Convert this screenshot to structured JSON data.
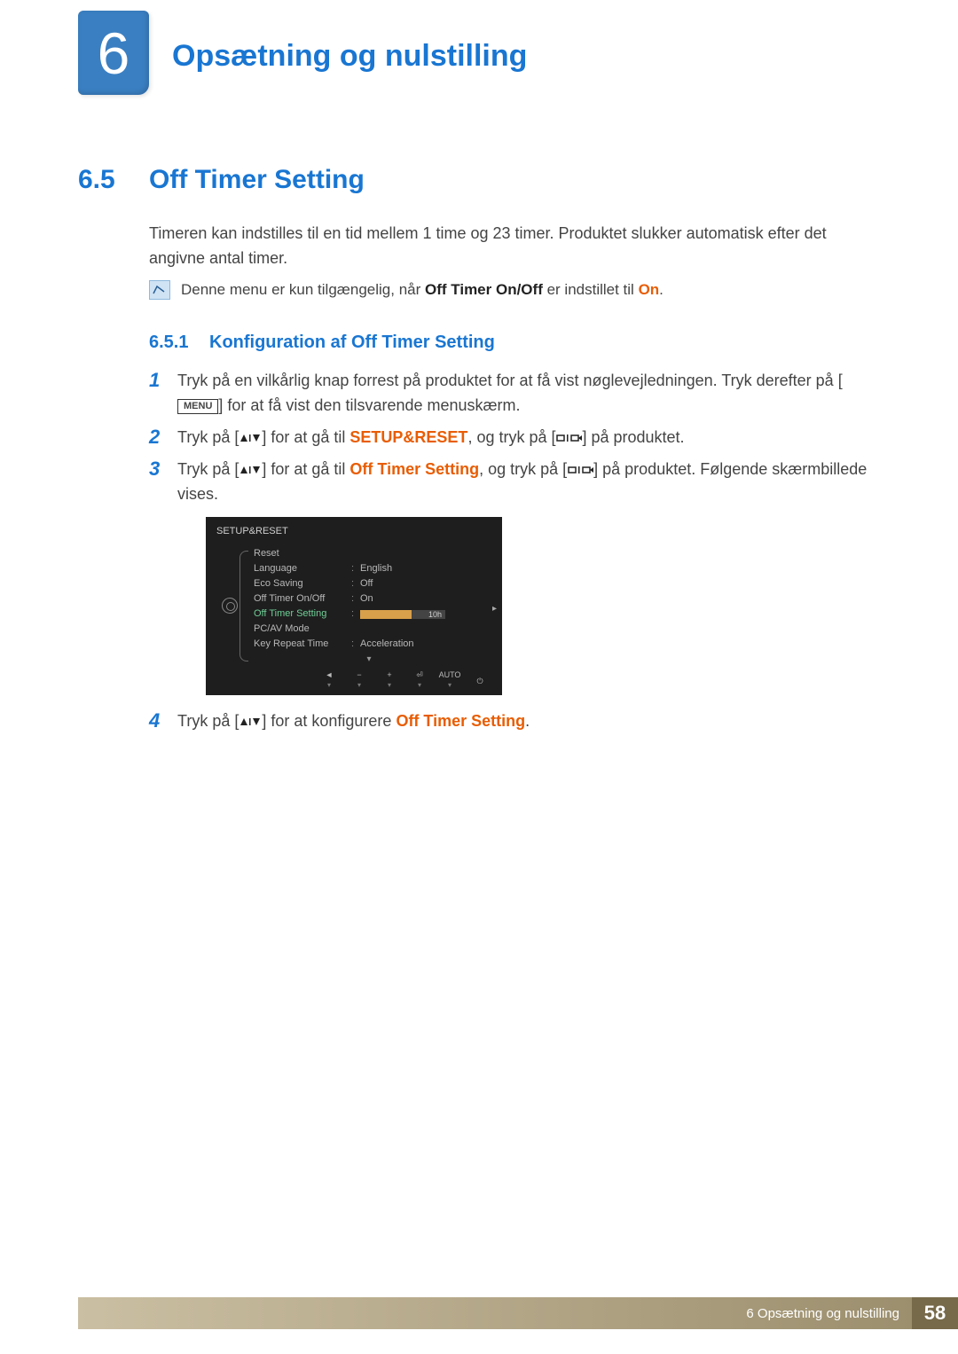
{
  "chapter": {
    "number": "6",
    "title": "Opsætning og nulstilling"
  },
  "section": {
    "number": "6.5",
    "title": "Off Timer Setting"
  },
  "intro": "Timeren kan indstilles til en tid mellem 1 time og 23 timer. Produktet slukker automatisk efter det angivne antal timer.",
  "note": {
    "prefix": "Denne menu er kun tilgængelig, når ",
    "bold1": "Off Timer On/Off",
    "mid": " er indstillet til ",
    "bold2": "On",
    "suffix": "."
  },
  "subsection": {
    "number": "6.5.1",
    "title": "Konfiguration af Off Timer Setting"
  },
  "steps": {
    "s1": {
      "num": "1",
      "a": "Tryk på en vilkårlig knap forrest på produktet for at få vist nøglevejledningen. Tryk derefter på [",
      "menu": "MENU",
      "b": "] for at få vist den tilsvarende menuskærm."
    },
    "s2": {
      "num": "2",
      "a": "Tryk på [",
      "b": "] for at gå til ",
      "target": "SETUP&RESET",
      "c": ", og tryk på [",
      "d": "] på produktet."
    },
    "s3": {
      "num": "3",
      "a": "Tryk på [",
      "b": "] for at gå til ",
      "target": "Off Timer Setting",
      "c": ", og tryk på [",
      "d": "] på produktet. Følgende skærmbillede vises."
    },
    "s4": {
      "num": "4",
      "a": "Tryk på [",
      "b": "] for at konfigurere ",
      "target": "Off Timer Setting",
      "c": "."
    }
  },
  "osd": {
    "title": "SETUP&RESET",
    "rows": [
      {
        "label": "Reset",
        "val": ""
      },
      {
        "label": "Language",
        "val": "English"
      },
      {
        "label": "Eco Saving",
        "val": "Off"
      },
      {
        "label": "Off Timer On/Off",
        "val": "On"
      },
      {
        "label": "Off Timer Setting",
        "val": "10h",
        "highlight": true,
        "slider": true
      },
      {
        "label": "PC/AV Mode",
        "val": ""
      },
      {
        "label": "Key Repeat Time",
        "val": "Acceleration"
      }
    ],
    "footer": [
      "◄",
      "−",
      "+",
      "⏎",
      "AUTO",
      "⏻"
    ]
  },
  "footer": {
    "text": "6 Opsætning og nulstilling",
    "page": "58"
  }
}
